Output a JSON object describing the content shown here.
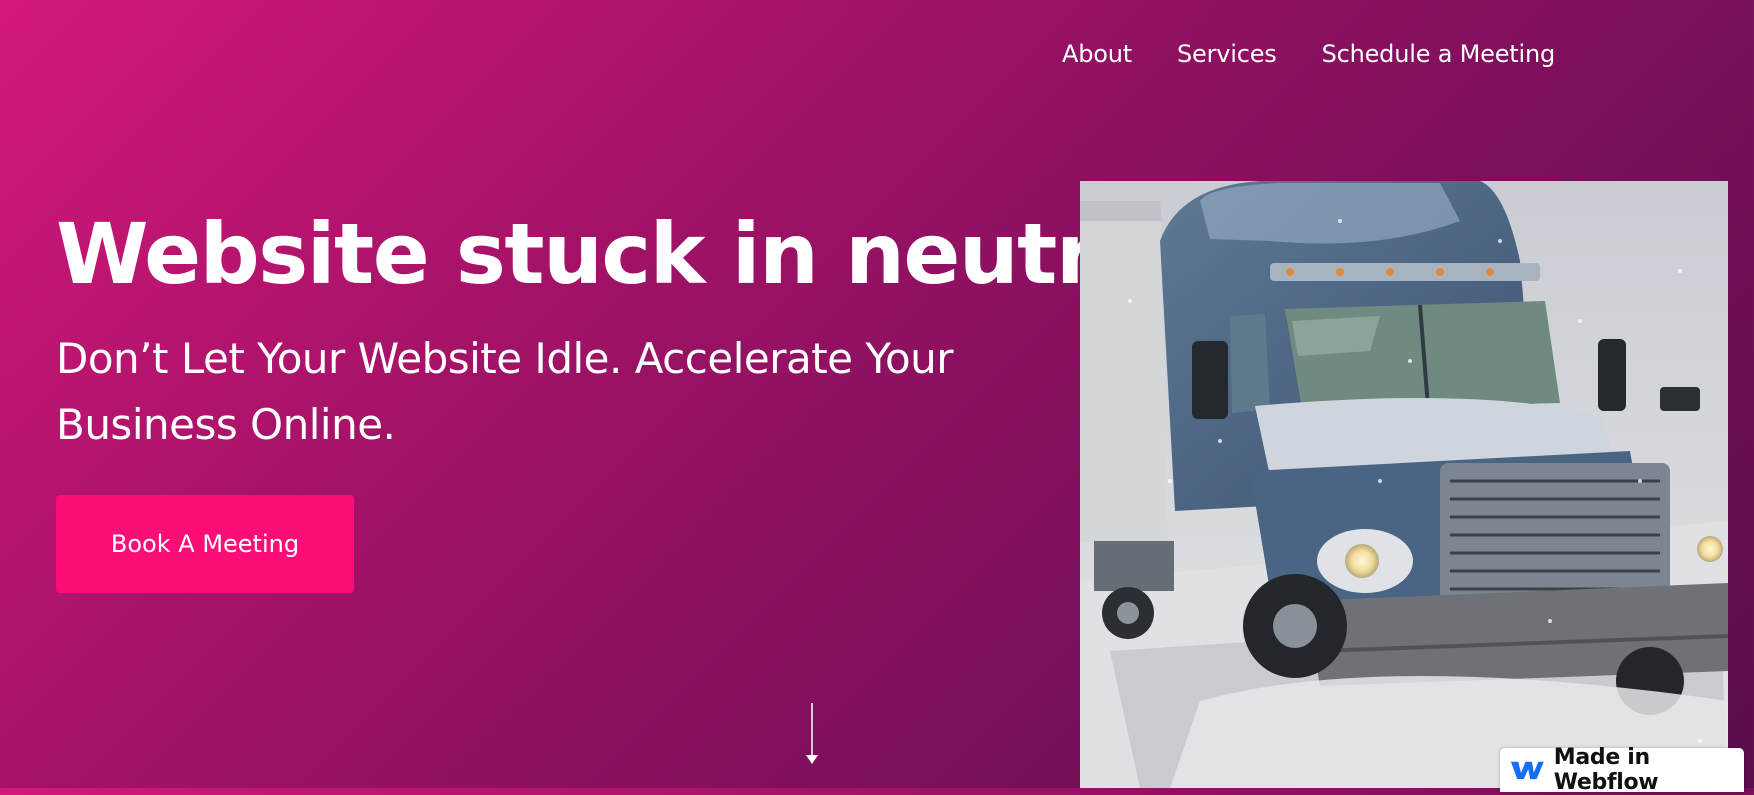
{
  "nav": {
    "items": [
      {
        "label": "About"
      },
      {
        "label": "Services"
      },
      {
        "label": "Schedule a Meeting"
      }
    ]
  },
  "hero": {
    "title": "Website stuck in neutral",
    "subtitle": "Don’t Let Your Website Idle. Accelerate Your Business Online.",
    "cta_label": "Book A Meeting",
    "scroll_icon": "arrow-down-icon",
    "image_icon": "semi-truck-in-snow"
  },
  "badge": {
    "label": "Made in Webflow",
    "icon": "webflow-logo-icon"
  },
  "colors": {
    "gradient_start": "#d3187a",
    "gradient_end": "#5a0d4c",
    "cta": "#fe0d78",
    "webflow_blue": "#146ef5"
  }
}
